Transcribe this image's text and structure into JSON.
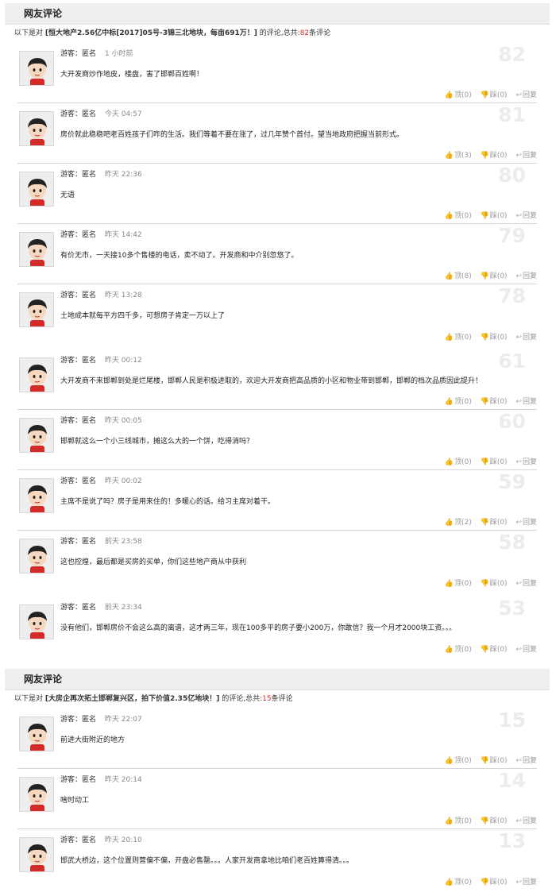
{
  "labels": {
    "user": "游客：匿名",
    "up": "顶",
    "down": "踩",
    "reply": "回复",
    "intro_prefix": "以下是对",
    "intro_mid": "的评论,总共:",
    "intro_suffix": "条评论"
  },
  "sections": [
    {
      "header": "网友评论",
      "topic": "[恒大地产2.56亿中标[2017]05号-3锦三北地块，每亩691万！]",
      "total": "82",
      "comments": [
        {
          "floor": "82",
          "time": "1 小时前",
          "text": "大开发商炒作地皮，楼盘，害了邯郸百姓啊！",
          "up": "(0)",
          "down": "(0)"
        },
        {
          "floor": "81",
          "time": "今天 04:57",
          "text": "房价就此稳稳吧老百姓孩子们咋的生活。我们等着不要在涨了，过几年赞个首付。望当地政府把握当前形式。",
          "up": "(3)",
          "down": "(0)"
        },
        {
          "floor": "80",
          "time": "昨天 22:36",
          "text": "无语",
          "up": "(0)",
          "down": "(0)"
        },
        {
          "floor": "79",
          "time": "昨天 14:42",
          "text": "有价无市，一天接10多个售楼的电话，卖不动了。开发商和中介别忽悠了。",
          "up": "(8)",
          "down": "(0)"
        },
        {
          "floor": "78",
          "time": "昨天 13:28",
          "text": "土地成本就每平方四千多，可想房子肯定一万以上了",
          "up": "(0)",
          "down": "(0)"
        }
      ]
    },
    {
      "header": "",
      "topic": "",
      "total": "",
      "comments": [
        {
          "floor": "61",
          "time": "昨天 00:12",
          "text": "大开发商不来邯郸到处是烂尾楼，邯郸人民是积极进取的，欢迎大开发商把高品质的小区和物业带到邯郸，邯郸的档次品质因此提升！",
          "up": "(0)",
          "down": "(0)"
        },
        {
          "floor": "60",
          "time": "昨天 00:05",
          "text": "邯郸就这么一个小三线城市，摊这么大的一个饼，吃得消吗？",
          "up": "(0)",
          "down": "(0)"
        },
        {
          "floor": "59",
          "time": "昨天 00:02",
          "text": "主席不是说了吗？房子是用来住的！多暖心的话。给习主席对着干。",
          "up": "(2)",
          "down": "(0)"
        },
        {
          "floor": "58",
          "time": "前天 23:58",
          "text": "这也控煌，最后都是买房的买单，你们这些地产商从中获利",
          "up": "(0)",
          "down": "(0)"
        }
      ]
    },
    {
      "header": "",
      "topic": "",
      "total": "",
      "comments": [
        {
          "floor": "53",
          "time": "前天 23:34",
          "text": "没有他们，邯郸房价不会这么高的离谱，这才两三年，现在100多平的房子要小200万，你敢信？我一个月才2000块工资。。。",
          "up": "(0)",
          "down": "(0)"
        }
      ]
    },
    {
      "header": "网友评论",
      "topic": "[大房企再次拓土邯郸复兴区，拍下价值2.35亿地块！]",
      "total": "15",
      "comments": [
        {
          "floor": "15",
          "time": "昨天 22:07",
          "text": "前进大街附近的地方",
          "up": "(0)",
          "down": "(0)"
        },
        {
          "floor": "14",
          "time": "昨天 20:14",
          "text": "啥时动工",
          "up": "(0)",
          "down": "(0)"
        },
        {
          "floor": "13",
          "time": "昨天 20:10",
          "text": "邯武大桥边，这个位置则营偏不偏，开盘必售罄。。。人家开发商拿地比咱们老百姓算得清。。。",
          "up": "(0)",
          "down": "(0)"
        }
      ]
    }
  ],
  "colors": {
    "accent_count": "#dd2222",
    "floor_number": "#ececec",
    "header_bg": "#efefef"
  },
  "icons": {
    "up": "thumbs-up-icon",
    "down": "thumbs-down-icon",
    "reply": "reply-icon",
    "avatar": "cartoon-boy-avatar"
  }
}
